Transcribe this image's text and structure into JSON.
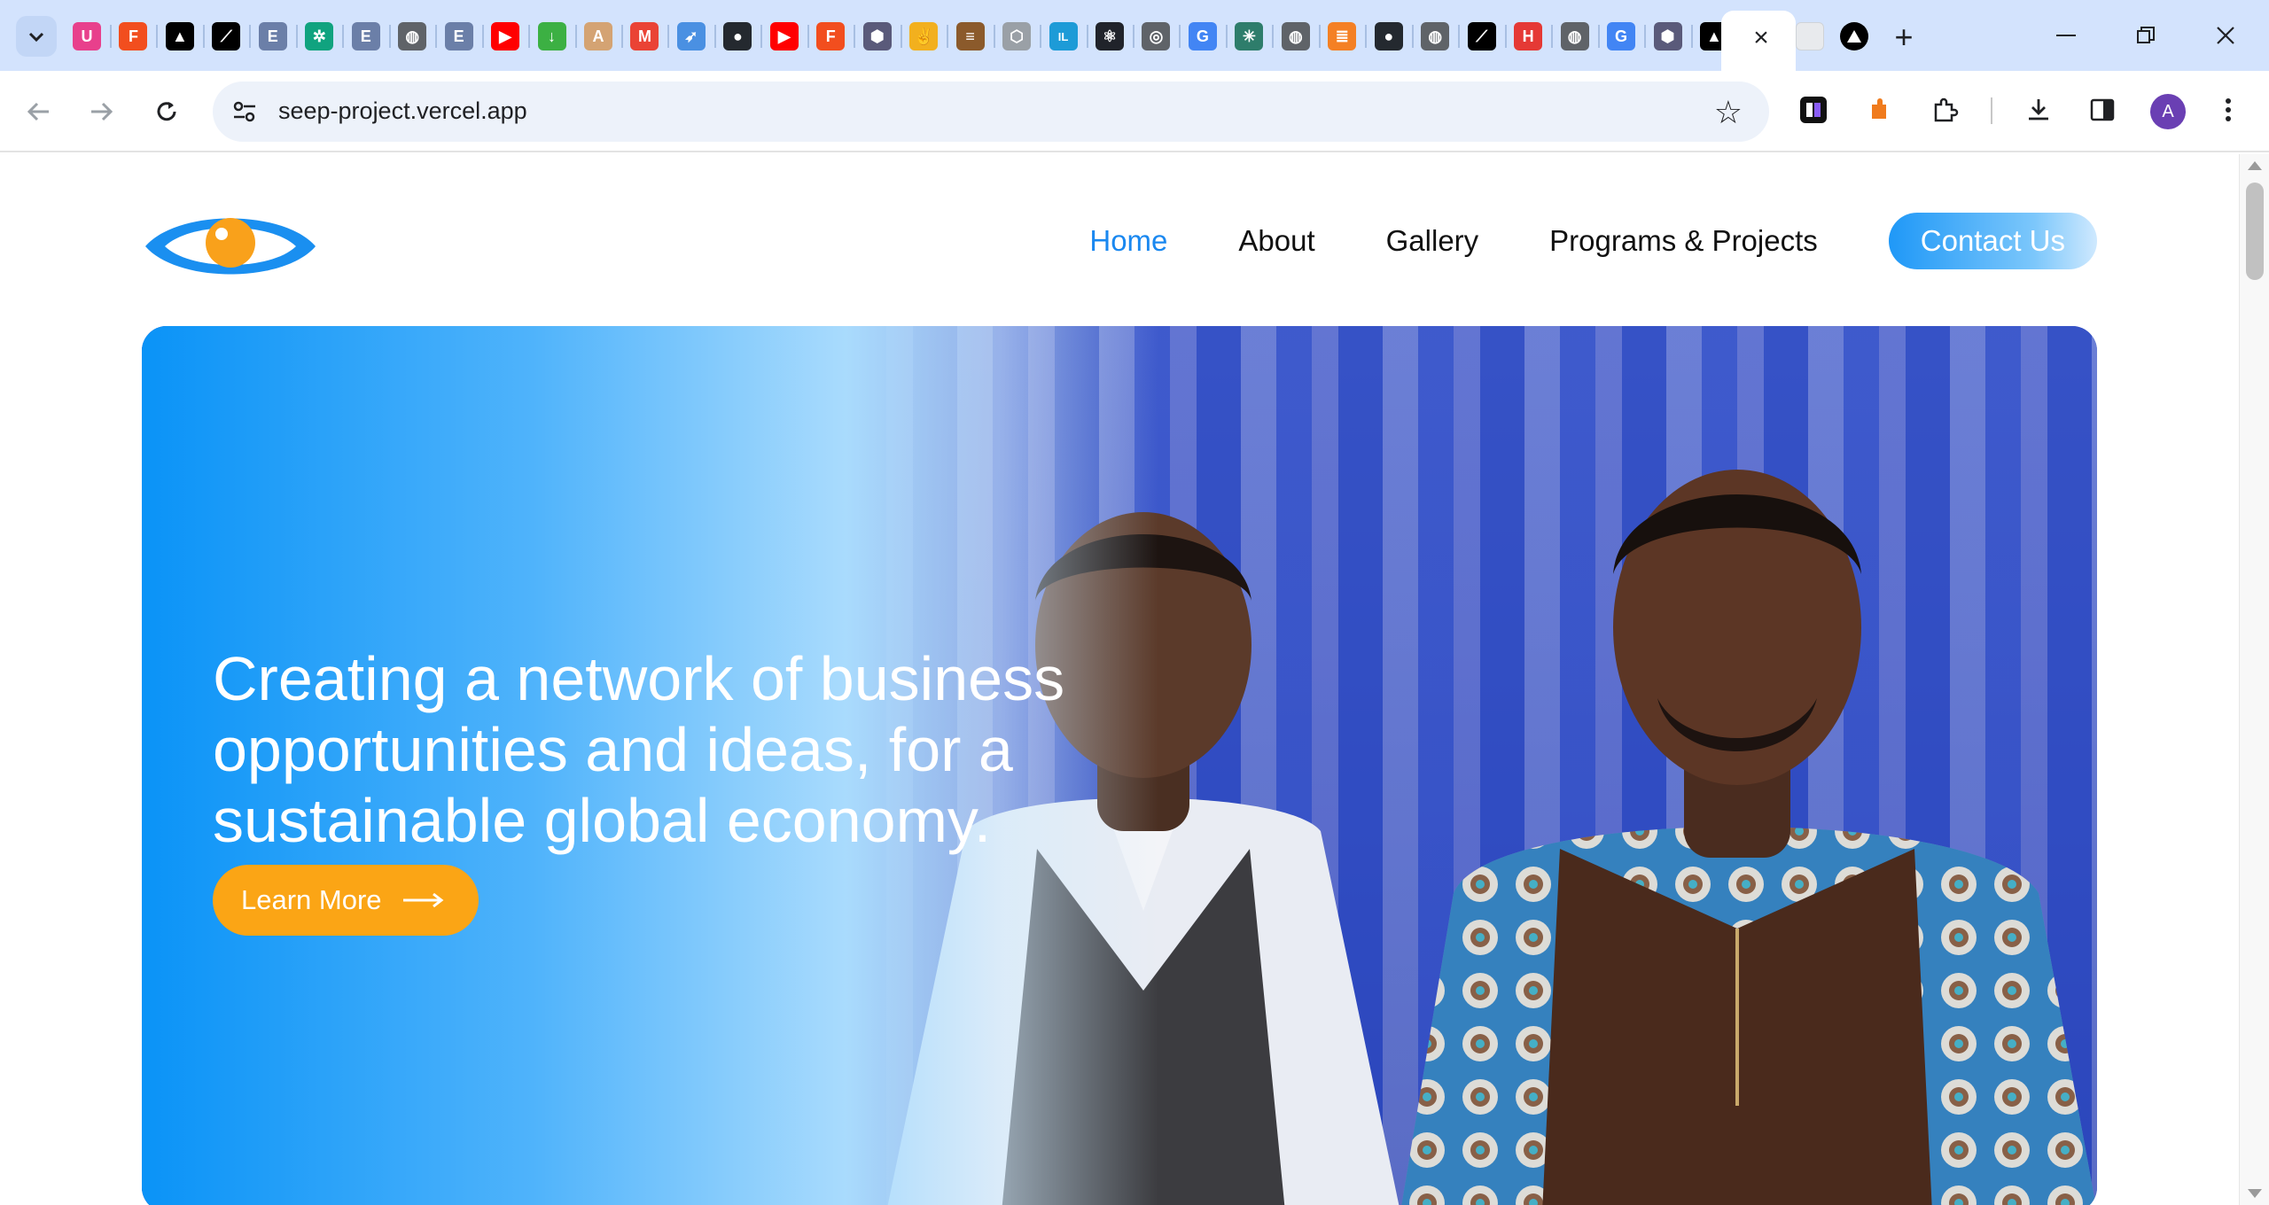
{
  "browser": {
    "url": "seep-project.vercel.app",
    "profile_initial": "A",
    "tab_favicons": [
      "unknown-u-icon",
      "figma-icon",
      "vercel-icon",
      "link-icon",
      "ebsco-icon",
      "openai-icon",
      "ebsco-icon",
      "globe-icon",
      "ebsco-icon",
      "youtube-icon",
      "download-icon",
      "anthropic-icon",
      "gmail-icon",
      "rocket-icon",
      "github-icon",
      "youtube-icon",
      "figma-icon",
      "shield-icon",
      "peace-hand-icon",
      "burger-icon",
      "hexagon-icon",
      "intellij-icon",
      "react-icon",
      "chrome-icon",
      "google-icon",
      "sparkle-icon",
      "globe-icon",
      "stackoverflow-icon",
      "github-icon",
      "globe-icon",
      "link-icon",
      "h-icon",
      "globe-icon",
      "google-icon",
      "shield-icon",
      "vercel-icon"
    ],
    "inactive_tab_favicons": [
      "blank-page-icon",
      "vercel-icon"
    ]
  },
  "site": {
    "nav": {
      "home": "Home",
      "about": "About",
      "gallery": "Gallery",
      "programs": "Programs & Projects",
      "contact": "Contact Us"
    },
    "hero": {
      "headline": "Creating a network of business opportunities and ideas, for a sustainable global economy.",
      "cta": "Learn More"
    },
    "colors": {
      "accent_blue": "#1a88f0",
      "cta_orange": "#fba515",
      "logo_blue": "#1a8ff0",
      "logo_orange": "#f9a11b"
    }
  }
}
